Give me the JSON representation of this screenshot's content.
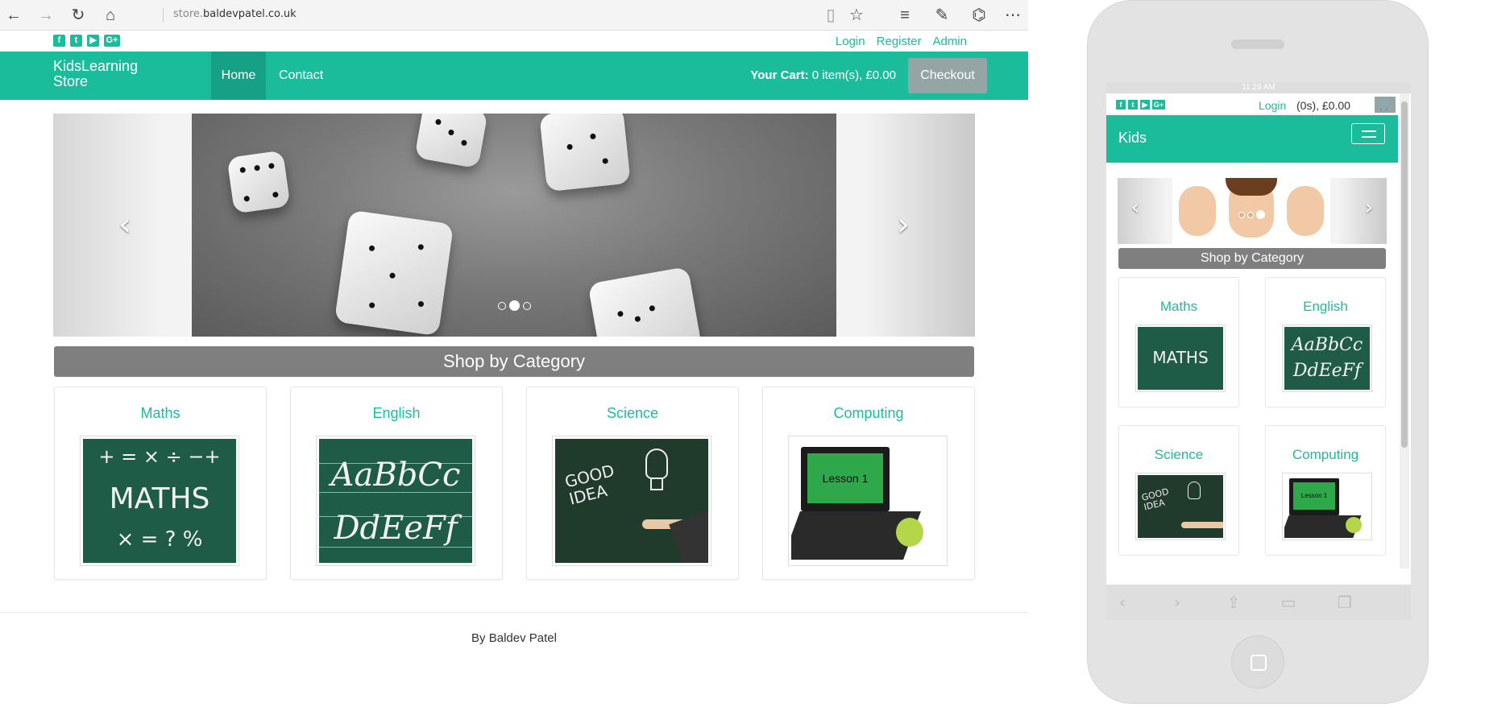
{
  "browser": {
    "url_dim": "store.",
    "url_main": "baldevpatel.co.uk",
    "back_icon": "←",
    "forward_icon": "→",
    "refresh_icon": "↻",
    "home_icon": "⌂",
    "reading_icon": "▯",
    "favorite_icon": "☆",
    "hub_icon": "≡",
    "note_icon": "✎",
    "share_icon": "⌬",
    "more_icon": "⋯"
  },
  "site": {
    "social": [
      "f",
      "t",
      "▶",
      "G+"
    ],
    "toplinks": [
      "Login",
      "Register",
      "Admin"
    ],
    "brand_line1": "KidsLearning",
    "brand_line2": "Store",
    "nav_home": "Home",
    "nav_contact": "Contact",
    "cart_label": "Your Cart:",
    "cart_value": " 0 item(s), £0.00",
    "checkout": "Checkout",
    "carousel_prev": "‹",
    "carousel_next": "›",
    "category_header": "Shop by Category",
    "categories": [
      "Maths",
      "English",
      "Science",
      "Computing"
    ],
    "maths_board_top": "+ = × ÷ −+",
    "maths_board_word": "MATHS",
    "maths_board_bottom": "× =  ? %",
    "english_board_line1": "AaBbCc",
    "english_board_line2": "DdEeFf",
    "science_board": "GOOD IDEA",
    "computing_screen": "Lesson 1",
    "footer": "By Baldev Patel",
    "accent": "#1abc9c",
    "accent_dark": "#16a085",
    "gray_header": "#7f7f7f"
  },
  "phone": {
    "status_time": "11:29 AM",
    "social": [
      "f",
      "t",
      "▶",
      "G+"
    ],
    "login": "Login",
    "cart_info": "(0s), £0.00",
    "cart_icon": "🛒",
    "brand": "Kids",
    "carousel_prev": "‹",
    "carousel_next": "›",
    "category_header": "Shop by Category",
    "categories": [
      "Maths",
      "English",
      "Science",
      "Computing"
    ],
    "maths_board_word": "MATHS",
    "english_board_line1": "AaBbCc",
    "english_board_line2": "DdEeFf",
    "science_board": "GOOD IDEA",
    "computing_screen": "Lesson 1",
    "bottom_back": "‹",
    "bottom_forward": "›",
    "bottom_share": "⇪",
    "bottom_book": "▭",
    "bottom_tabs": "❐"
  }
}
